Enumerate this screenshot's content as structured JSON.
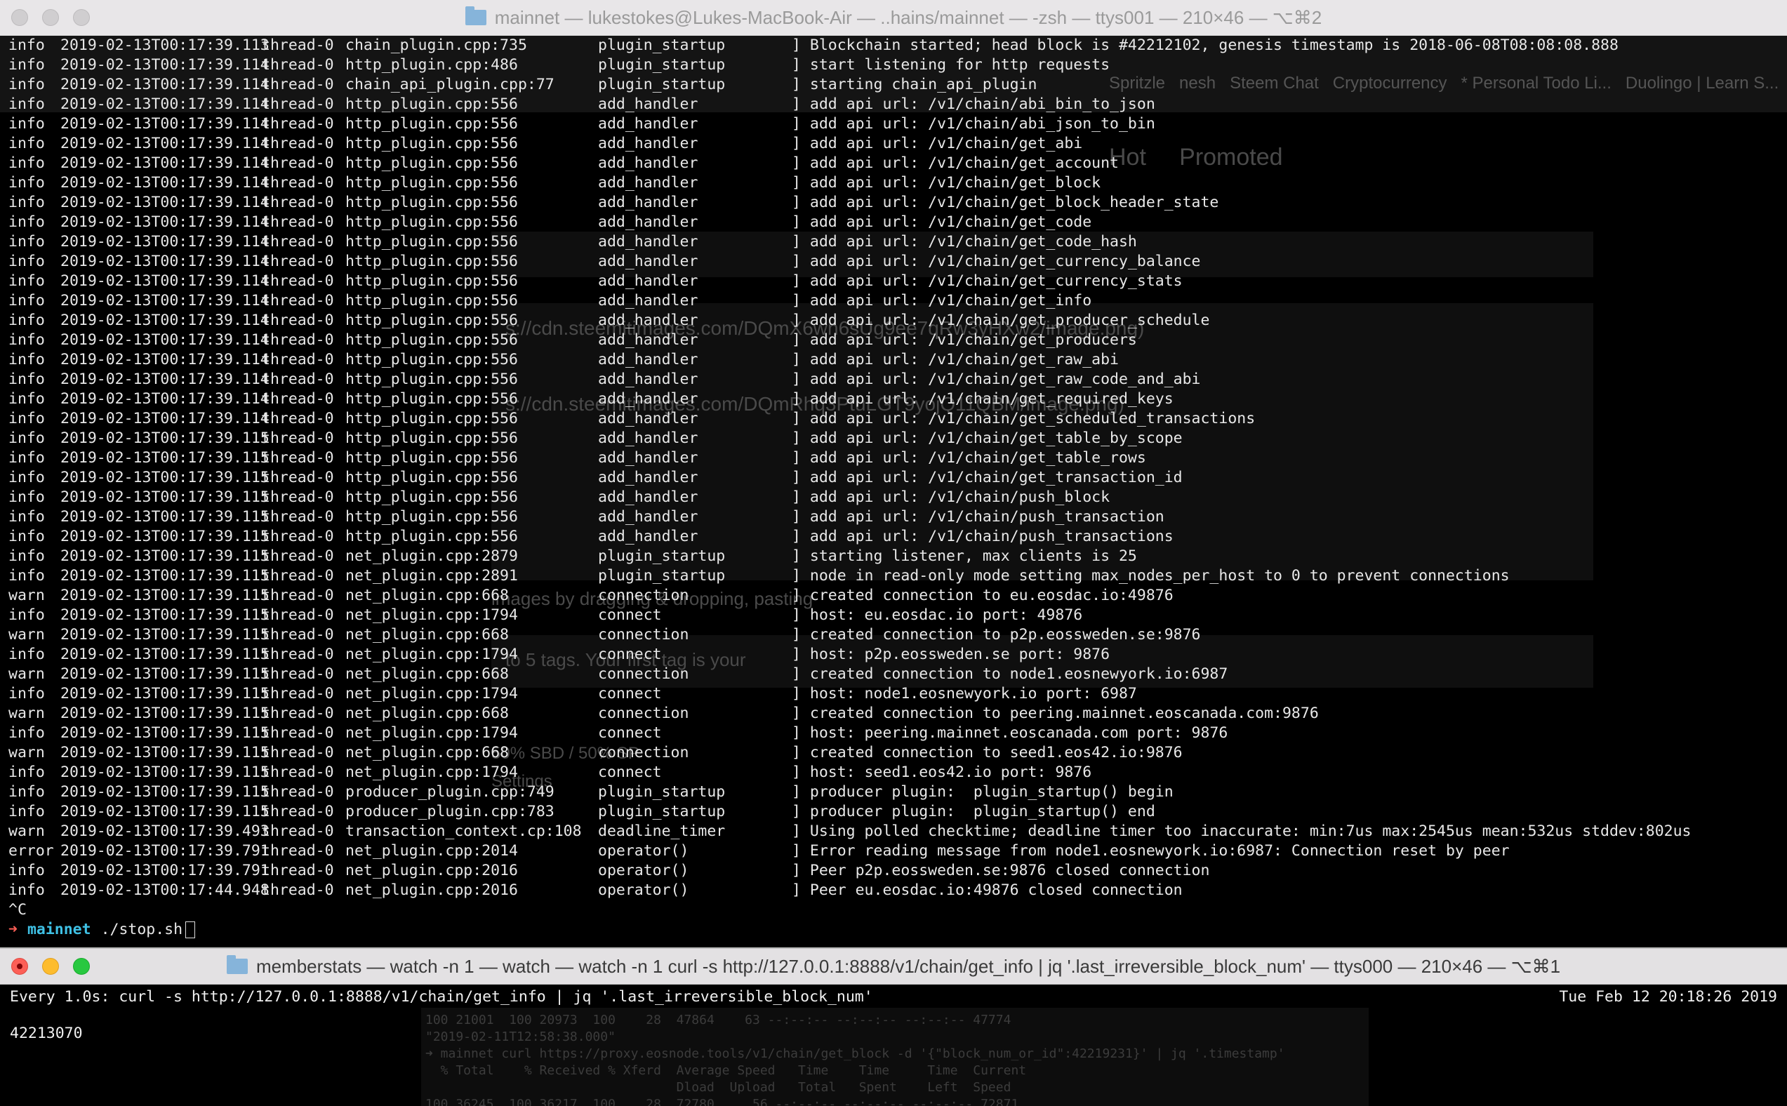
{
  "window1": {
    "title": "mainnet — lukestokes@Lukes-MacBook-Air — ..hains/mainnet — -zsh — ttys001 — 210×46 — ⌥⌘2",
    "ghost_bookmarks": "Spritzle   nesh   Steem Chat   Cryptocurrency   * Personal Todo Li...   Duolingo | Learn S...",
    "ghost_tabs": "Hot     Promoted",
    "ghost_urls": [
      "s://cdn.steemitimages.com/DQmX6wn6sUg9ee7qRw3yHXw2/image.png)",
      "s://cdn.steemitimages.com/DQmRhq3PtuLGT9yojQ11QBM/image.png)"
    ],
    "ghost_hints": [
      "images by dragging & dropping, pasting",
      "to 5 tags. Your first tag is your",
      "50% SBD / 50% SP",
      "Settings"
    ],
    "log_rows": [
      {
        "level": "info",
        "ts": "2019-02-13T00:17:39.113",
        "thread": "thread-0",
        "file": "chain_plugin.cpp:735",
        "func": "plugin_startup",
        "msg": "] Blockchain started; head block is #42212102, genesis timestamp is 2018-06-08T08:08:08.888"
      },
      {
        "level": "info",
        "ts": "2019-02-13T00:17:39.114",
        "thread": "thread-0",
        "file": "http_plugin.cpp:486",
        "func": "plugin_startup",
        "msg": "] start listening for http requests"
      },
      {
        "level": "info",
        "ts": "2019-02-13T00:17:39.114",
        "thread": "thread-0",
        "file": "chain_api_plugin.cpp:77",
        "func": "plugin_startup",
        "msg": "] starting chain_api_plugin"
      },
      {
        "level": "info",
        "ts": "2019-02-13T00:17:39.114",
        "thread": "thread-0",
        "file": "http_plugin.cpp:556",
        "func": "add_handler",
        "msg": "] add api url: /v1/chain/abi_bin_to_json"
      },
      {
        "level": "info",
        "ts": "2019-02-13T00:17:39.114",
        "thread": "thread-0",
        "file": "http_plugin.cpp:556",
        "func": "add_handler",
        "msg": "] add api url: /v1/chain/abi_json_to_bin"
      },
      {
        "level": "info",
        "ts": "2019-02-13T00:17:39.114",
        "thread": "thread-0",
        "file": "http_plugin.cpp:556",
        "func": "add_handler",
        "msg": "] add api url: /v1/chain/get_abi"
      },
      {
        "level": "info",
        "ts": "2019-02-13T00:17:39.114",
        "thread": "thread-0",
        "file": "http_plugin.cpp:556",
        "func": "add_handler",
        "msg": "] add api url: /v1/chain/get_account"
      },
      {
        "level": "info",
        "ts": "2019-02-13T00:17:39.114",
        "thread": "thread-0",
        "file": "http_plugin.cpp:556",
        "func": "add_handler",
        "msg": "] add api url: /v1/chain/get_block"
      },
      {
        "level": "info",
        "ts": "2019-02-13T00:17:39.114",
        "thread": "thread-0",
        "file": "http_plugin.cpp:556",
        "func": "add_handler",
        "msg": "] add api url: /v1/chain/get_block_header_state"
      },
      {
        "level": "info",
        "ts": "2019-02-13T00:17:39.114",
        "thread": "thread-0",
        "file": "http_plugin.cpp:556",
        "func": "add_handler",
        "msg": "] add api url: /v1/chain/get_code"
      },
      {
        "level": "info",
        "ts": "2019-02-13T00:17:39.114",
        "thread": "thread-0",
        "file": "http_plugin.cpp:556",
        "func": "add_handler",
        "msg": "] add api url: /v1/chain/get_code_hash"
      },
      {
        "level": "info",
        "ts": "2019-02-13T00:17:39.114",
        "thread": "thread-0",
        "file": "http_plugin.cpp:556",
        "func": "add_handler",
        "msg": "] add api url: /v1/chain/get_currency_balance"
      },
      {
        "level": "info",
        "ts": "2019-02-13T00:17:39.114",
        "thread": "thread-0",
        "file": "http_plugin.cpp:556",
        "func": "add_handler",
        "msg": "] add api url: /v1/chain/get_currency_stats"
      },
      {
        "level": "info",
        "ts": "2019-02-13T00:17:39.114",
        "thread": "thread-0",
        "file": "http_plugin.cpp:556",
        "func": "add_handler",
        "msg": "] add api url: /v1/chain/get_info"
      },
      {
        "level": "info",
        "ts": "2019-02-13T00:17:39.114",
        "thread": "thread-0",
        "file": "http_plugin.cpp:556",
        "func": "add_handler",
        "msg": "] add api url: /v1/chain/get_producer_schedule"
      },
      {
        "level": "info",
        "ts": "2019-02-13T00:17:39.114",
        "thread": "thread-0",
        "file": "http_plugin.cpp:556",
        "func": "add_handler",
        "msg": "] add api url: /v1/chain/get_producers"
      },
      {
        "level": "info",
        "ts": "2019-02-13T00:17:39.114",
        "thread": "thread-0",
        "file": "http_plugin.cpp:556",
        "func": "add_handler",
        "msg": "] add api url: /v1/chain/get_raw_abi"
      },
      {
        "level": "info",
        "ts": "2019-02-13T00:17:39.114",
        "thread": "thread-0",
        "file": "http_plugin.cpp:556",
        "func": "add_handler",
        "msg": "] add api url: /v1/chain/get_raw_code_and_abi"
      },
      {
        "level": "info",
        "ts": "2019-02-13T00:17:39.114",
        "thread": "thread-0",
        "file": "http_plugin.cpp:556",
        "func": "add_handler",
        "msg": "] add api url: /v1/chain/get_required_keys"
      },
      {
        "level": "info",
        "ts": "2019-02-13T00:17:39.114",
        "thread": "thread-0",
        "file": "http_plugin.cpp:556",
        "func": "add_handler",
        "msg": "] add api url: /v1/chain/get_scheduled_transactions"
      },
      {
        "level": "info",
        "ts": "2019-02-13T00:17:39.115",
        "thread": "thread-0",
        "file": "http_plugin.cpp:556",
        "func": "add_handler",
        "msg": "] add api url: /v1/chain/get_table_by_scope"
      },
      {
        "level": "info",
        "ts": "2019-02-13T00:17:39.115",
        "thread": "thread-0",
        "file": "http_plugin.cpp:556",
        "func": "add_handler",
        "msg": "] add api url: /v1/chain/get_table_rows"
      },
      {
        "level": "info",
        "ts": "2019-02-13T00:17:39.115",
        "thread": "thread-0",
        "file": "http_plugin.cpp:556",
        "func": "add_handler",
        "msg": "] add api url: /v1/chain/get_transaction_id"
      },
      {
        "level": "info",
        "ts": "2019-02-13T00:17:39.115",
        "thread": "thread-0",
        "file": "http_plugin.cpp:556",
        "func": "add_handler",
        "msg": "] add api url: /v1/chain/push_block"
      },
      {
        "level": "info",
        "ts": "2019-02-13T00:17:39.115",
        "thread": "thread-0",
        "file": "http_plugin.cpp:556",
        "func": "add_handler",
        "msg": "] add api url: /v1/chain/push_transaction"
      },
      {
        "level": "info",
        "ts": "2019-02-13T00:17:39.115",
        "thread": "thread-0",
        "file": "http_plugin.cpp:556",
        "func": "add_handler",
        "msg": "] add api url: /v1/chain/push_transactions"
      },
      {
        "level": "info",
        "ts": "2019-02-13T00:17:39.115",
        "thread": "thread-0",
        "file": "net_plugin.cpp:2879",
        "func": "plugin_startup",
        "msg": "] starting listener, max clients is 25"
      },
      {
        "level": "info",
        "ts": "2019-02-13T00:17:39.115",
        "thread": "thread-0",
        "file": "net_plugin.cpp:2891",
        "func": "plugin_startup",
        "msg": "] node in read-only mode setting max_nodes_per_host to 0 to prevent connections"
      },
      {
        "level": "warn",
        "ts": "2019-02-13T00:17:39.115",
        "thread": "thread-0",
        "file": "net_plugin.cpp:668",
        "func": "connection",
        "msg": "] created connection to eu.eosdac.io:49876"
      },
      {
        "level": "info",
        "ts": "2019-02-13T00:17:39.115",
        "thread": "thread-0",
        "file": "net_plugin.cpp:1794",
        "func": "connect",
        "msg": "] host: eu.eosdac.io port: 49876"
      },
      {
        "level": "warn",
        "ts": "2019-02-13T00:17:39.115",
        "thread": "thread-0",
        "file": "net_plugin.cpp:668",
        "func": "connection",
        "msg": "] created connection to p2p.eossweden.se:9876"
      },
      {
        "level": "info",
        "ts": "2019-02-13T00:17:39.115",
        "thread": "thread-0",
        "file": "net_plugin.cpp:1794",
        "func": "connect",
        "msg": "] host: p2p.eossweden.se port: 9876"
      },
      {
        "level": "warn",
        "ts": "2019-02-13T00:17:39.115",
        "thread": "thread-0",
        "file": "net_plugin.cpp:668",
        "func": "connection",
        "msg": "] created connection to node1.eosnewyork.io:6987"
      },
      {
        "level": "info",
        "ts": "2019-02-13T00:17:39.115",
        "thread": "thread-0",
        "file": "net_plugin.cpp:1794",
        "func": "connect",
        "msg": "] host: node1.eosnewyork.io port: 6987"
      },
      {
        "level": "warn",
        "ts": "2019-02-13T00:17:39.115",
        "thread": "thread-0",
        "file": "net_plugin.cpp:668",
        "func": "connection",
        "msg": "] created connection to peering.mainnet.eoscanada.com:9876"
      },
      {
        "level": "info",
        "ts": "2019-02-13T00:17:39.115",
        "thread": "thread-0",
        "file": "net_plugin.cpp:1794",
        "func": "connect",
        "msg": "] host: peering.mainnet.eoscanada.com port: 9876"
      },
      {
        "level": "warn",
        "ts": "2019-02-13T00:17:39.115",
        "thread": "thread-0",
        "file": "net_plugin.cpp:668",
        "func": "connection",
        "msg": "] created connection to seed1.eos42.io:9876"
      },
      {
        "level": "info",
        "ts": "2019-02-13T00:17:39.115",
        "thread": "thread-0",
        "file": "net_plugin.cpp:1794",
        "func": "connect",
        "msg": "] host: seed1.eos42.io port: 9876"
      },
      {
        "level": "info",
        "ts": "2019-02-13T00:17:39.115",
        "thread": "thread-0",
        "file": "producer_plugin.cpp:749",
        "func": "plugin_startup",
        "msg": "] producer plugin:  plugin_startup() begin"
      },
      {
        "level": "info",
        "ts": "2019-02-13T00:17:39.115",
        "thread": "thread-0",
        "file": "producer_plugin.cpp:783",
        "func": "plugin_startup",
        "msg": "] producer plugin:  plugin_startup() end"
      },
      {
        "level": "warn",
        "ts": "2019-02-13T00:17:39.493",
        "thread": "thread-0",
        "file": "transaction_context.cp:108",
        "func": "deadline_timer",
        "msg": "] Using polled checktime; deadline timer too inaccurate: min:7us max:2545us mean:532us stddev:802us"
      },
      {
        "level": "error",
        "ts": "2019-02-13T00:17:39.791",
        "thread": "thread-0",
        "file": "net_plugin.cpp:2014",
        "func": "operator()",
        "msg": "] Error reading message from node1.eosnewyork.io:6987: Connection reset by peer"
      },
      {
        "level": "info",
        "ts": "2019-02-13T00:17:39.791",
        "thread": "thread-0",
        "file": "net_plugin.cpp:2016",
        "func": "operator()",
        "msg": "] Peer p2p.eossweden.se:9876 closed connection"
      },
      {
        "level": "info",
        "ts": "2019-02-13T00:17:44.948",
        "thread": "thread-0",
        "file": "net_plugin.cpp:2016",
        "func": "operator()",
        "msg": "] Peer eu.eosdac.io:49876 closed connection"
      }
    ],
    "interrupt": "^C",
    "prompt_arrow": "➜",
    "prompt_dir": "mainnet",
    "prompt_command": "./stop.sh"
  },
  "window2": {
    "title": "memberstats — watch -n 1 — watch — watch -n 1 curl -s http://127.0.0.1:8888/v1/chain/get_info | jq '.last_irreversible_block_num' — ttys000 — 210×46 — ⌥⌘1",
    "watch_command": "Every 1.0s: curl -s http://127.0.0.1:8888/v1/chain/get_info | jq '.last_irreversible_block_num'",
    "watch_time": "Tue Feb 12 20:18:26 2019",
    "value": "42213070",
    "ghost_lines": "100 21001  100 20973  100    28  47864    63 --:--:-- --:--:-- --:--:-- 47774\n\"2019-02-11T12:58:38.000\"\n➜ mainnet curl https://proxy.eosnode.tools/v1/chain/get_block -d '{\"block_num_or_id\":42219231}' | jq '.timestamp'\n  % Total    % Received % Xferd  Average Speed   Time    Time     Time  Current\n                                 Dload  Upload   Total   Spent    Left  Speed\n100 36245  100 36217  100    28  72780     56 --:--:-- --:--:-- --:--:-- 72871"
  },
  "colors": {
    "terminal_bg": "#000000",
    "text": "#e8e8e8",
    "prompt_arrow": "#ff5f56",
    "prompt_dir": "#3fc1e5"
  }
}
